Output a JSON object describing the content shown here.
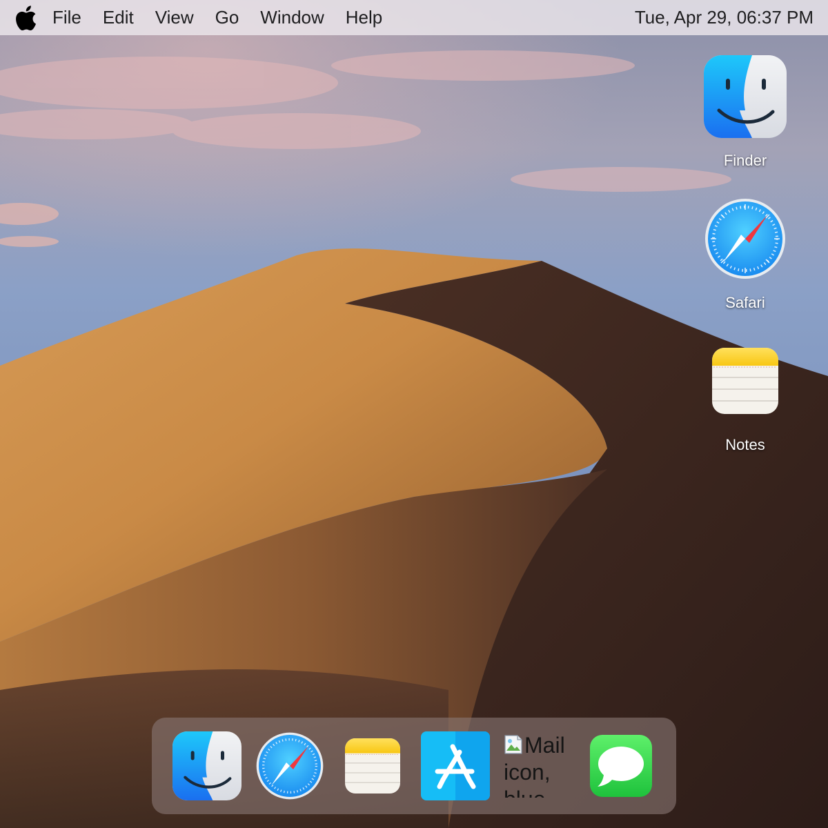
{
  "menubar": {
    "menus": [
      "File",
      "Edit",
      "View",
      "Go",
      "Window",
      "Help"
    ],
    "clock": "Tue, Apr 29, 06:37 PM"
  },
  "desktop": {
    "icons": [
      {
        "label": "Finder",
        "icon": "finder-icon"
      },
      {
        "label": "Safari",
        "icon": "safari-icon"
      },
      {
        "label": "Notes",
        "icon": "notes-icon"
      }
    ]
  },
  "dock": {
    "items": [
      {
        "icon": "finder-icon"
      },
      {
        "icon": "safari-icon"
      },
      {
        "icon": "notes-icon"
      },
      {
        "icon": "app-store-icon"
      },
      {
        "icon": "mail-icon",
        "alt_text": "Mail icon, blue"
      },
      {
        "icon": "messages-icon"
      }
    ]
  },
  "colors": {
    "menubar_bg": "#ECE6EC",
    "finder_blue": "#1E8BF5",
    "safari_blue": "#2AA8F5",
    "notes_yellow": "#FDD236",
    "appstore_blue": "#12B1F4",
    "messages_green": "#2FD24C"
  }
}
